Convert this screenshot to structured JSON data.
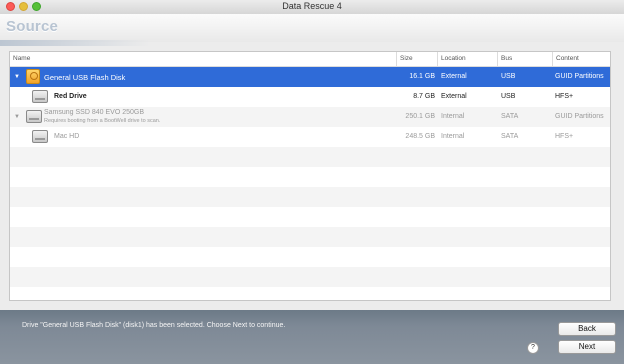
{
  "window": {
    "title": "Data Rescue 4"
  },
  "header": {
    "title": "Source"
  },
  "table": {
    "columns": [
      "Name",
      "Size",
      "Location",
      "Bus",
      "Content"
    ],
    "rows": [
      {
        "name": "General USB Flash Disk",
        "sub": "",
        "size": "16.1 GB",
        "location": "External",
        "bus": "USB",
        "content": "GUID Partitions",
        "icon": "usb-drive-icon",
        "disclosure": "▼"
      },
      {
        "name": "Red Drive",
        "sub": "",
        "size": "8.7 GB",
        "location": "External",
        "bus": "USB",
        "content": "HFS+",
        "icon": "volume-icon",
        "disclosure": ""
      },
      {
        "name": "Samsung SSD 840 EVO 250GB",
        "sub": "Requires booting from a BootWell drive to scan.",
        "size": "250.1 GB",
        "location": "Internal",
        "bus": "SATA",
        "content": "GUID Partitions",
        "icon": "hard-drive-icon",
        "disclosure": "▼"
      },
      {
        "name": "Mac HD",
        "sub": "",
        "size": "248.5 GB",
        "location": "Internal",
        "bus": "SATA",
        "content": "HFS+",
        "icon": "volume-icon",
        "disclosure": ""
      }
    ]
  },
  "footer": {
    "status": "Drive \"General USB Flash Disk\" (disk1) has been selected. Choose Next to continue.",
    "help_label": "?",
    "back_label": "Back",
    "next_label": "Next"
  }
}
